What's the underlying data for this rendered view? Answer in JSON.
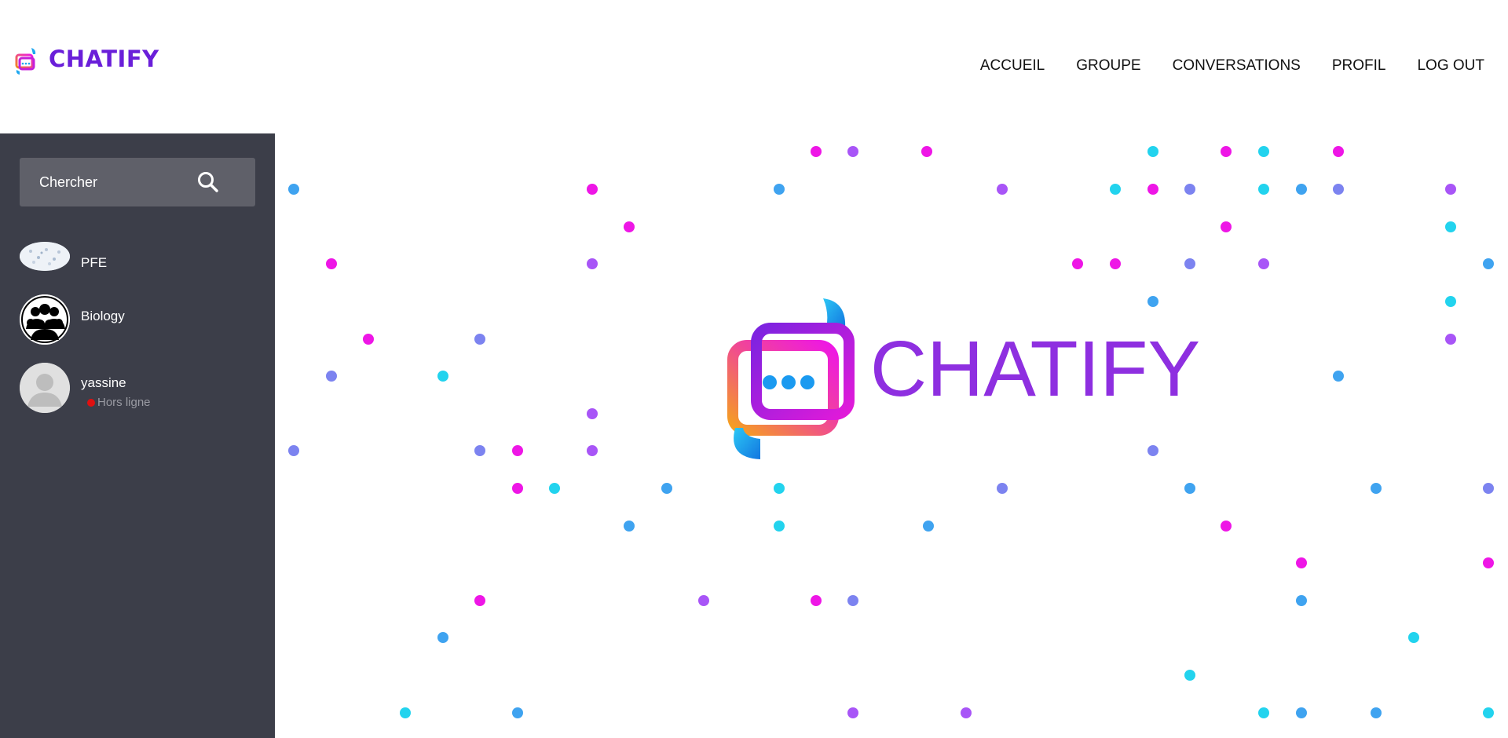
{
  "header": {
    "brand": "CHATIFY",
    "nav": [
      "ACCUEIL",
      "GROUPE",
      "CONVERSATIONS",
      "PROFIL",
      "LOG OUT"
    ]
  },
  "sidebar": {
    "search": {
      "placeholder": "Chercher"
    },
    "conversations": [
      {
        "name": "PFE",
        "avatar": "group-photo-thumbnail"
      },
      {
        "name": "Biology",
        "avatar": "group-people-icon"
      },
      {
        "name": "yassine",
        "avatar": "user-placeholder-icon",
        "status": "Hors ligne",
        "status_color": "#e01010"
      }
    ]
  },
  "main": {
    "hero_title": "CHATIFY",
    "hero_logo": "chat-logo-icon",
    "dot_colors": [
      "#ee16e6",
      "#a855f7",
      "#22d3ee",
      "#3fa3f0",
      "#7c83f0"
    ]
  },
  "colors": {
    "brand": "#6a1fd9",
    "hero_text": "#8e2fe0",
    "sidebar_bg": "#3c3e49",
    "search_bg": "#5f6069"
  }
}
